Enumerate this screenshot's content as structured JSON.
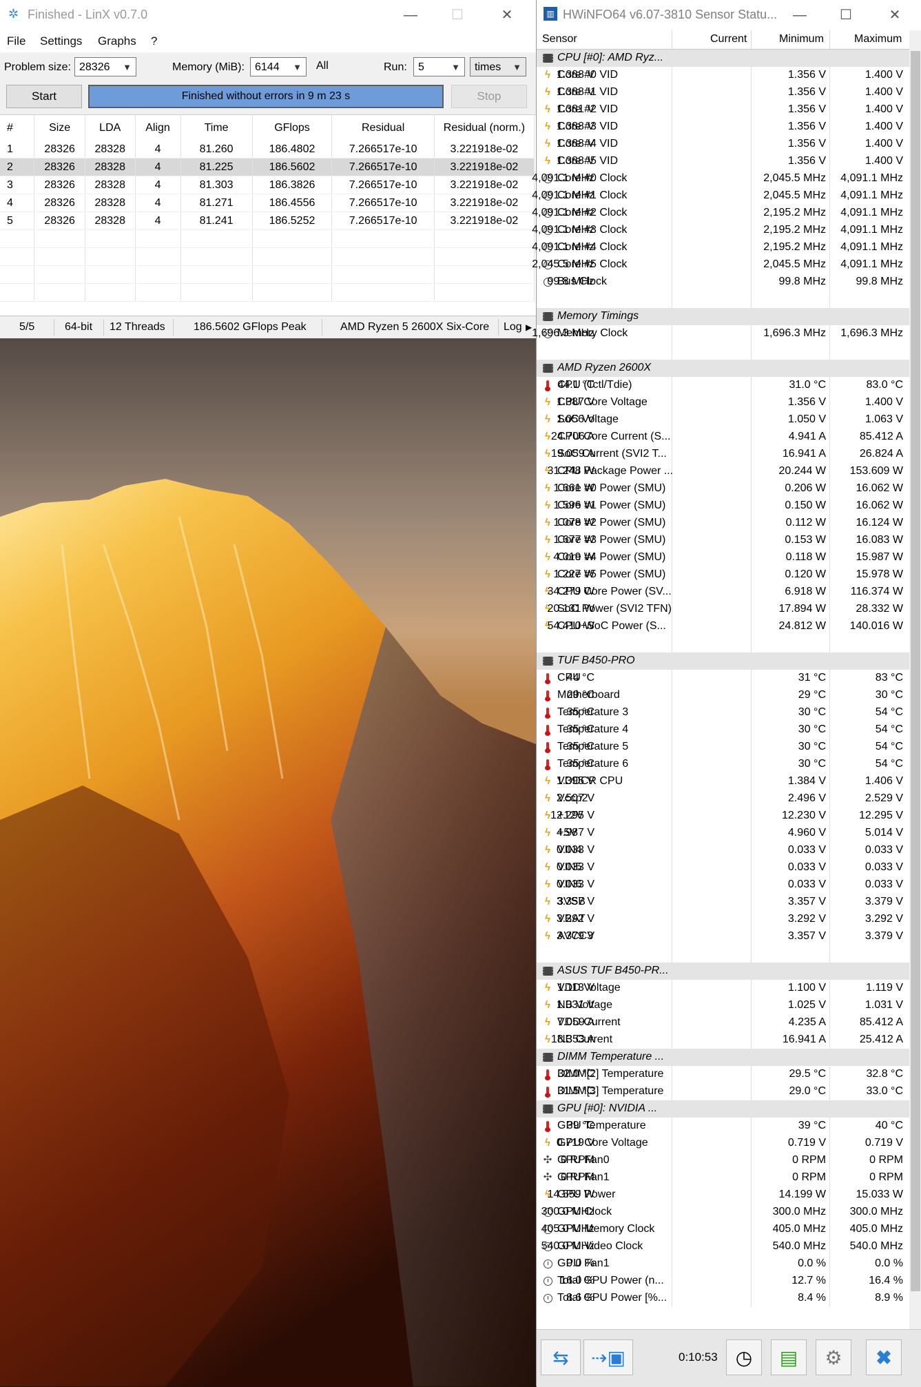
{
  "linx": {
    "title": "Finished - LinX v0.7.0",
    "menu": [
      "File",
      "Settings",
      "Graphs",
      "?"
    ],
    "problem_size_label": "Problem size:",
    "problem_size_value": "28326",
    "memory_label": "Memory (MiB):",
    "memory_value": "6144",
    "all_label": "All",
    "run_label": "Run:",
    "run_value": "5",
    "run_unit": "times",
    "start_label": "Start",
    "stop_label": "Stop",
    "progress_text": "Finished without errors in 9 m 23 s",
    "progress_fraction": 1.0,
    "columns": [
      "#",
      "Size",
      "LDA",
      "Align",
      "Time",
      "GFlops",
      "Residual",
      "Residual (norm.)"
    ],
    "rows": [
      [
        "1",
        "28326",
        "28328",
        "4",
        "81.260",
        "186.4802",
        "7.266517e-10",
        "3.221918e-02"
      ],
      [
        "2",
        "28326",
        "28328",
        "4",
        "81.225",
        "186.5602",
        "7.266517e-10",
        "3.221918e-02"
      ],
      [
        "3",
        "28326",
        "28328",
        "4",
        "81.303",
        "186.3826",
        "7.266517e-10",
        "3.221918e-02"
      ],
      [
        "4",
        "28326",
        "28328",
        "4",
        "81.271",
        "186.4556",
        "7.266517e-10",
        "3.221918e-02"
      ],
      [
        "5",
        "28326",
        "28328",
        "4",
        "81.241",
        "186.5252",
        "7.266517e-10",
        "3.221918e-02"
      ]
    ],
    "selected_row": 1,
    "status": {
      "runs": "5/5",
      "bits": "64-bit",
      "threads": "12 Threads",
      "peak": "186.5602 GFlops Peak",
      "cpu": "AMD Ryzen 5 2600X Six-Core",
      "log": "Log"
    }
  },
  "hwinfo": {
    "title": "HWiNFO64 v6.07-3810 Sensor Statu...",
    "columns": [
      "Sensor",
      "Current",
      "Minimum",
      "Maximum"
    ],
    "elapsed": "0:10:53",
    "rows": [
      {
        "type": "group",
        "icon": "chip",
        "name": "CPU [#0]: AMD Ryz..."
      },
      {
        "icon": "volt",
        "name": "Core #0 VID",
        "cur": "1.388 V",
        "min": "1.356 V",
        "max": "1.400 V"
      },
      {
        "icon": "volt",
        "name": "Core #1 VID",
        "cur": "1.388 V",
        "min": "1.356 V",
        "max": "1.400 V"
      },
      {
        "icon": "volt",
        "name": "Core #2 VID",
        "cur": "1.381 V",
        "min": "1.356 V",
        "max": "1.400 V"
      },
      {
        "icon": "volt",
        "name": "Core #3 VID",
        "cur": "1.388 V",
        "min": "1.356 V",
        "max": "1.400 V"
      },
      {
        "icon": "volt",
        "name": "Core #4 VID",
        "cur": "1.388 V",
        "min": "1.356 V",
        "max": "1.400 V"
      },
      {
        "icon": "volt",
        "name": "Core #5 VID",
        "cur": "1.388 V",
        "min": "1.356 V",
        "max": "1.400 V"
      },
      {
        "icon": "clock",
        "name": "Core #0 Clock",
        "cur": "4,091.1 MHz",
        "min": "2,045.5 MHz",
        "max": "4,091.1 MHz"
      },
      {
        "icon": "clock",
        "name": "Core #1 Clock",
        "cur": "4,091.1 MHz",
        "min": "2,045.5 MHz",
        "max": "4,091.1 MHz"
      },
      {
        "icon": "clock",
        "name": "Core #2 Clock",
        "cur": "4,091.1 MHz",
        "min": "2,195.2 MHz",
        "max": "4,091.1 MHz"
      },
      {
        "icon": "clock",
        "name": "Core #3 Clock",
        "cur": "4,091.1 MHz",
        "min": "2,195.2 MHz",
        "max": "4,091.1 MHz"
      },
      {
        "icon": "clock",
        "name": "Core #4 Clock",
        "cur": "4,091.1 MHz",
        "min": "2,195.2 MHz",
        "max": "4,091.1 MHz"
      },
      {
        "icon": "clock",
        "name": "Core #5 Clock",
        "cur": "2,045.5 MHz",
        "min": "2,045.5 MHz",
        "max": "4,091.1 MHz"
      },
      {
        "icon": "clock",
        "name": "Bus Clock",
        "cur": "99.8 MHz",
        "min": "99.8 MHz",
        "max": "99.8 MHz"
      },
      {
        "type": "spacer"
      },
      {
        "type": "group",
        "icon": "chip",
        "name": "Memory Timings"
      },
      {
        "icon": "clock",
        "name": "Memory Clock",
        "cur": "1,696.3 MHz",
        "min": "1,696.3 MHz",
        "max": "1,696.3 MHz"
      },
      {
        "type": "spacer"
      },
      {
        "type": "group",
        "icon": "chip",
        "name": "AMD Ryzen 2600X"
      },
      {
        "icon": "therm",
        "name": "CPU (Tctl/Tdie)",
        "cur": "44.1 °C",
        "min": "31.0 °C",
        "max": "83.0 °C"
      },
      {
        "icon": "volt",
        "name": "CPU Core Voltage",
        "cur": "1.387 V",
        "min": "1.356 V",
        "max": "1.400 V"
      },
      {
        "icon": "volt",
        "name": "SoC Voltage",
        "cur": "1.056 V",
        "min": "1.050 V",
        "max": "1.063 V"
      },
      {
        "icon": "volt",
        "name": "CPU Core Current (S...",
        "cur": "24.706 A",
        "min": "4.941 A",
        "max": "85.412 A"
      },
      {
        "icon": "volt",
        "name": "SoC Current (SVI2 T...",
        "cur": "19.059 A",
        "min": "16.941 A",
        "max": "26.824 A"
      },
      {
        "icon": "volt",
        "name": "CPU Package Power ...",
        "cur": "31.248 W",
        "min": "20.244 W",
        "max": "153.609 W"
      },
      {
        "icon": "volt",
        "name": "Core #0 Power (SMU)",
        "cur": "1.661 W",
        "min": "0.206 W",
        "max": "16.062 W"
      },
      {
        "icon": "volt",
        "name": "Core #1 Power (SMU)",
        "cur": "1.596 W",
        "min": "0.150 W",
        "max": "16.062 W"
      },
      {
        "icon": "volt",
        "name": "Core #2 Power (SMU)",
        "cur": "1.078 W",
        "min": "0.112 W",
        "max": "16.124 W"
      },
      {
        "icon": "volt",
        "name": "Core #3 Power (SMU)",
        "cur": "1.677 W",
        "min": "0.153 W",
        "max": "16.083 W"
      },
      {
        "icon": "volt",
        "name": "Core #4 Power (SMU)",
        "cur": "4.019 W",
        "min": "0.118 W",
        "max": "15.987 W"
      },
      {
        "icon": "volt",
        "name": "Core #5 Power (SMU)",
        "cur": "1.227 W",
        "min": "0.120 W",
        "max": "15.978 W"
      },
      {
        "icon": "volt",
        "name": "CPU Core Power (SV...",
        "cur": "34.279 W",
        "min": "6.918 W",
        "max": "116.374 W"
      },
      {
        "icon": "volt",
        "name": "SoC Power (SVI2 TFN)",
        "cur": "20.131 W",
        "min": "17.894 W",
        "max": "28.332 W"
      },
      {
        "icon": "volt",
        "name": "CPU+SoC Power (S...",
        "cur": "54.410 W",
        "min": "24.812 W",
        "max": "140.016 W"
      },
      {
        "type": "spacer"
      },
      {
        "type": "group",
        "icon": "chip",
        "name": "TUF B450-PRO"
      },
      {
        "icon": "therm",
        "name": "CPU",
        "cur": "44 °C",
        "min": "31 °C",
        "max": "83 °C"
      },
      {
        "icon": "therm",
        "name": "Motherboard",
        "cur": "29 °C",
        "min": "29 °C",
        "max": "30 °C"
      },
      {
        "icon": "therm",
        "name": "Temperature 3",
        "cur": "35 °C",
        "min": "30 °C",
        "max": "54 °C"
      },
      {
        "icon": "therm",
        "name": "Temperature 4",
        "cur": "35 °C",
        "min": "30 °C",
        "max": "54 °C"
      },
      {
        "icon": "therm",
        "name": "Temperature 5",
        "cur": "35 °C",
        "min": "30 °C",
        "max": "54 °C"
      },
      {
        "icon": "therm",
        "name": "Temperature 6",
        "cur": "35 °C",
        "min": "30 °C",
        "max": "54 °C"
      },
      {
        "icon": "volt",
        "name": "VDDCR CPU",
        "cur": "1.395 V",
        "min": "1.384 V",
        "max": "1.406 V"
      },
      {
        "icon": "volt",
        "name": "Vccp2",
        "cur": "2.507 V",
        "min": "2.496 V",
        "max": "2.529 V"
      },
      {
        "icon": "volt",
        "name": "+12V",
        "cur": "12.295 V",
        "min": "12.230 V",
        "max": "12.295 V"
      },
      {
        "icon": "volt",
        "name": "+5V",
        "cur": "4.987 V",
        "min": "4.960 V",
        "max": "5.014 V"
      },
      {
        "icon": "volt",
        "name": "VIN4",
        "cur": "0.033 V",
        "min": "0.033 V",
        "max": "0.033 V"
      },
      {
        "icon": "volt",
        "name": "VIN5",
        "cur": "0.033 V",
        "min": "0.033 V",
        "max": "0.033 V"
      },
      {
        "icon": "volt",
        "name": "VIN6",
        "cur": "0.033 V",
        "min": "0.033 V",
        "max": "0.033 V"
      },
      {
        "icon": "volt",
        "name": "3VSB",
        "cur": "3.357 V",
        "min": "3.357 V",
        "max": "3.379 V"
      },
      {
        "icon": "volt",
        "name": "VBAT",
        "cur": "3.292 V",
        "min": "3.292 V",
        "max": "3.292 V"
      },
      {
        "icon": "volt",
        "name": "AVCC3",
        "cur": "3.379 V",
        "min": "3.357 V",
        "max": "3.379 V"
      },
      {
        "type": "spacer"
      },
      {
        "type": "group",
        "icon": "chip",
        "name": "ASUS TUF B450-PR..."
      },
      {
        "icon": "volt",
        "name": "VDD Voltage",
        "cur": "1.113 V",
        "min": "1.100 V",
        "max": "1.119 V"
      },
      {
        "icon": "volt",
        "name": "NB Voltage",
        "cur": "1.031 V",
        "min": "1.025 V",
        "max": "1.031 V"
      },
      {
        "icon": "volt",
        "name": "VDD Current",
        "cur": "7.059 A",
        "min": "4.235 A",
        "max": "85.412 A"
      },
      {
        "icon": "volt",
        "name": "NB Current",
        "cur": "18.353 A",
        "min": "16.941 A",
        "max": "25.412 A"
      },
      {
        "type": "group",
        "icon": "chip",
        "name": "DIMM Temperature ..."
      },
      {
        "icon": "therm",
        "name": "DIMM[2] Temperature",
        "cur": "32.0 °C",
        "min": "29.5 °C",
        "max": "32.8 °C"
      },
      {
        "icon": "therm",
        "name": "DIMM[3] Temperature",
        "cur": "31.5 °C",
        "min": "29.0 °C",
        "max": "33.0 °C"
      },
      {
        "type": "group",
        "icon": "chip",
        "name": "GPU [#0]: NVIDIA ..."
      },
      {
        "icon": "therm",
        "name": "GPU Temperature",
        "cur": "39 °C",
        "min": "39 °C",
        "max": "40 °C"
      },
      {
        "icon": "volt",
        "name": "GPU Core Voltage",
        "cur": "0.719 V",
        "min": "0.719 V",
        "max": "0.719 V"
      },
      {
        "icon": "fan",
        "name": "GPU Fan0",
        "cur": "0 RPM",
        "min": "0 RPM",
        "max": "0 RPM"
      },
      {
        "icon": "fan",
        "name": "GPU Fan1",
        "cur": "0 RPM",
        "min": "0 RPM",
        "max": "0 RPM"
      },
      {
        "icon": "volt",
        "name": "GPU Power",
        "cur": "14.559 W",
        "min": "14.199 W",
        "max": "15.033 W"
      },
      {
        "icon": "clock",
        "name": "GPU Clock",
        "cur": "300.0 MHz",
        "min": "300.0 MHz",
        "max": "300.0 MHz"
      },
      {
        "icon": "clock",
        "name": "GPU Memory Clock",
        "cur": "405.0 MHz",
        "min": "405.0 MHz",
        "max": "405.0 MHz"
      },
      {
        "icon": "clock",
        "name": "GPU Video Clock",
        "cur": "540.0 MHz",
        "min": "540.0 MHz",
        "max": "540.0 MHz"
      },
      {
        "icon": "clock",
        "name": "GPU Fan1",
        "cur": "0.0 %",
        "min": "0.0 %",
        "max": "0.0 %"
      },
      {
        "icon": "clock",
        "name": "Total GPU Power (n...",
        "cur": "16.0 %",
        "min": "12.7 %",
        "max": "16.4 %"
      },
      {
        "icon": "clock",
        "name": "Total GPU Power [%...",
        "cur": "8.6 %",
        "min": "8.4 %",
        "max": "8.9 %"
      }
    ]
  }
}
